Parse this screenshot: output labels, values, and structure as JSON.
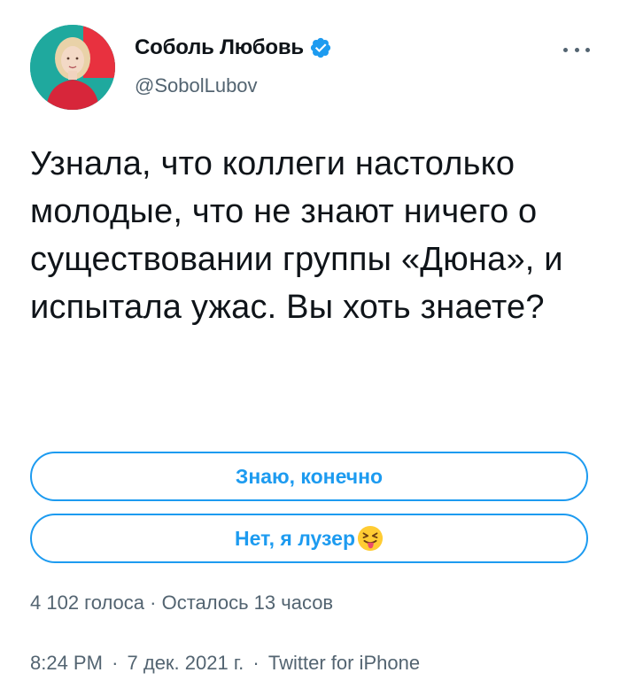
{
  "author": {
    "display_name": "Соболь Любовь",
    "handle": "@SobolLubov",
    "verified": true,
    "verified_icon": "verified-badge-icon"
  },
  "tweet": {
    "text": "Узнала, что коллеги настолько молодые, что не знают ничего о существовании группы «Дюна», и испытала ужас. Вы хоть знаете?"
  },
  "poll": {
    "options": [
      {
        "label": "Знаю, конечно"
      },
      {
        "label": "Нет, я лузер",
        "emoji": "squinting-face-with-tongue-icon"
      }
    ],
    "votes": "4 102 голоса",
    "remaining": "Осталось 13 часов",
    "separator": "·"
  },
  "meta": {
    "time": "8:24 PM",
    "date": "7 дек. 2021 г.",
    "source": "Twitter for iPhone",
    "separator": "·"
  },
  "colors": {
    "accent": "#1d9bf0",
    "text": "#0f1419",
    "secondary": "#536471",
    "avatar_bg": "#1fa99e"
  }
}
